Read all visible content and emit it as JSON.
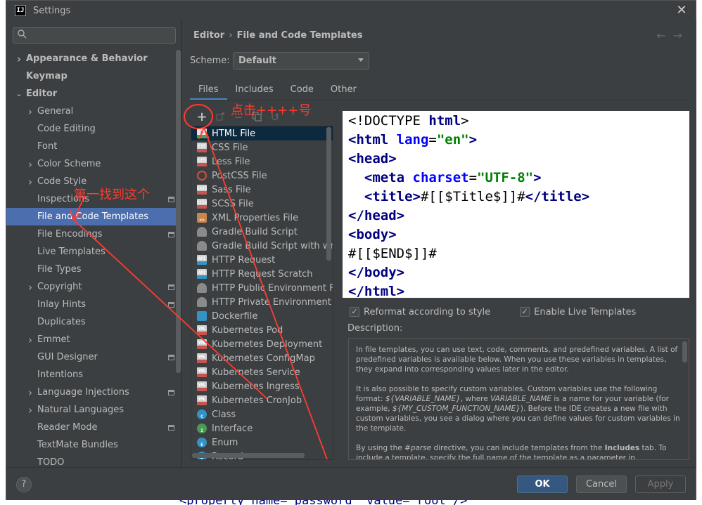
{
  "window": {
    "title": "Settings",
    "logo": "IJ"
  },
  "background_code": "<property name=\"password\" value=\"root\"/>",
  "search": {
    "placeholder": ""
  },
  "sidebar": {
    "items": [
      {
        "label": "Appearance & Behavior",
        "bold": true,
        "arrow": "right",
        "indent": 0
      },
      {
        "label": "Keymap",
        "bold": true,
        "arrow": "",
        "indent": 0
      },
      {
        "label": "Editor",
        "bold": true,
        "arrow": "down",
        "indent": 0
      },
      {
        "label": "General",
        "arrow": "right",
        "indent": 1
      },
      {
        "label": "Code Editing",
        "arrow": "",
        "indent": 1
      },
      {
        "label": "Font",
        "arrow": "",
        "indent": 1
      },
      {
        "label": "Color Scheme",
        "arrow": "right",
        "indent": 1
      },
      {
        "label": "Code Style",
        "arrow": "right",
        "indent": 1
      },
      {
        "label": "Inspections",
        "arrow": "",
        "indent": 1,
        "badge": true
      },
      {
        "label": "File and Code Templates",
        "arrow": "",
        "indent": 1,
        "selected": true
      },
      {
        "label": "File Encodings",
        "arrow": "",
        "indent": 1,
        "badge": true
      },
      {
        "label": "Live Templates",
        "arrow": "",
        "indent": 1
      },
      {
        "label": "File Types",
        "arrow": "",
        "indent": 1
      },
      {
        "label": "Copyright",
        "arrow": "right",
        "indent": 1,
        "badge": true
      },
      {
        "label": "Inlay Hints",
        "arrow": "",
        "indent": 1,
        "badge": true
      },
      {
        "label": "Duplicates",
        "arrow": "",
        "indent": 1
      },
      {
        "label": "Emmet",
        "arrow": "right",
        "indent": 1
      },
      {
        "label": "GUI Designer",
        "arrow": "",
        "indent": 1,
        "badge": true
      },
      {
        "label": "Intentions",
        "arrow": "",
        "indent": 1
      },
      {
        "label": "Language Injections",
        "arrow": "right",
        "indent": 1,
        "badge": true
      },
      {
        "label": "Natural Languages",
        "arrow": "right",
        "indent": 1
      },
      {
        "label": "Reader Mode",
        "arrow": "",
        "indent": 1,
        "badge": true
      },
      {
        "label": "TextMate Bundles",
        "arrow": "",
        "indent": 1
      },
      {
        "label": "TODO",
        "arrow": "",
        "indent": 1
      }
    ]
  },
  "breadcrumb": {
    "parent": "Editor",
    "current": "File and Code Templates"
  },
  "scheme": {
    "label": "Scheme:",
    "value": "Default"
  },
  "tabs": [
    {
      "label": "Files",
      "active": true
    },
    {
      "label": "Includes"
    },
    {
      "label": "Code"
    },
    {
      "label": "Other"
    }
  ],
  "templates": [
    {
      "label": "HTML File",
      "icon": "html",
      "tag": "H",
      "selected": true
    },
    {
      "label": "CSS File",
      "icon": "css",
      "tag": "CSS"
    },
    {
      "label": "Less File",
      "icon": "less",
      "tag": "LES"
    },
    {
      "label": "PostCSS File",
      "icon": "postcss",
      "tag": ""
    },
    {
      "label": "Sass File",
      "icon": "sass",
      "tag": "SASS"
    },
    {
      "label": "SCSS File",
      "icon": "sass",
      "tag": "SCSS"
    },
    {
      "label": "XML Properties File",
      "icon": "xml",
      "tag": "<>"
    },
    {
      "label": "Gradle Build Script",
      "icon": "gradle",
      "tag": ""
    },
    {
      "label": "Gradle Build Script with wrapper",
      "icon": "gradle",
      "tag": ""
    },
    {
      "label": "HTTP Request",
      "icon": "api",
      "tag": "API"
    },
    {
      "label": "HTTP Request Scratch",
      "icon": "api",
      "tag": "API"
    },
    {
      "label": "HTTP Public Environment File",
      "icon": "gradle",
      "tag": ""
    },
    {
      "label": "HTTP Private Environment File",
      "icon": "gradle",
      "tag": ""
    },
    {
      "label": "Dockerfile",
      "icon": "docker",
      "tag": ""
    },
    {
      "label": "Kubernetes Pod",
      "icon": "yml",
      "tag": "YML"
    },
    {
      "label": "Kubernetes Deployment",
      "icon": "yml",
      "tag": "YML"
    },
    {
      "label": "Kubernetes ConfigMap",
      "icon": "yml",
      "tag": "YML"
    },
    {
      "label": "Kubernetes Service",
      "icon": "yml",
      "tag": "YML"
    },
    {
      "label": "Kubernetes Ingress",
      "icon": "yml",
      "tag": "YML"
    },
    {
      "label": "Kubernetes CronJob",
      "icon": "yml",
      "tag": "YML"
    },
    {
      "label": "Class",
      "icon": "class",
      "tag": "C"
    },
    {
      "label": "Interface",
      "icon": "iface",
      "tag": "I"
    },
    {
      "label": "Enum",
      "icon": "enum",
      "tag": "E"
    },
    {
      "label": "Record",
      "icon": "record",
      "tag": "R"
    }
  ],
  "code": {
    "doctype": "<!DOCTYPE ",
    "doctype_kw": "html",
    "html_open": "<html",
    "lang_attr": " lang",
    "lang_eq": "=",
    "lang_val": "\"en\"",
    "head_open": "<head>",
    "meta": "  <meta",
    "charset_attr": " charset",
    "charset_val": "\"UTF-8\"",
    "title_open": "  <title>",
    "title_var": "#[[$Title$]]#",
    "title_close": "</title>",
    "head_close": "</head>",
    "body_open": "<body>",
    "end_var": "#[[$END$]]#",
    "body_close": "</body>",
    "html_close": "</html>"
  },
  "options": {
    "reformat_label": "Reformat according to style",
    "live_templates_label": "Enable Live Templates"
  },
  "description": {
    "label": "Description:",
    "p1": "In file templates, you can use text, code, comments, and predefined variables. A list of predefined variables is available below. When you use these variables in templates, they expand into corresponding values later in the editor.",
    "p2a": "It is also possible to specify custom variables. Custom variables use the following format: ",
    "p2b": "${VARIABLE_NAME}",
    "p2c": ", where ",
    "p2d": "VARIABLE_NAME",
    "p2e": " is a name for your variable (for example, ",
    "p2f": "${MY_CUSTOM_FUNCTION_NAME}",
    "p2g": "). Before the IDE creates a new file with custom variables, you see a dialog where you can define values for custom variables in the template.",
    "p3a": "By using the ",
    "p3b": "#parse",
    "p3c": " directive, you can include templates from the ",
    "p3d": "Includes",
    "p3e": " tab. To include a template, specify the full name of the template as a parameter in"
  },
  "footer": {
    "help": "?",
    "ok": "OK",
    "cancel": "Cancel",
    "apply": "Apply"
  },
  "annotations": {
    "click_plus": "点击++++号",
    "find_first": "第一找到这个",
    "color": "#ff3b30"
  }
}
